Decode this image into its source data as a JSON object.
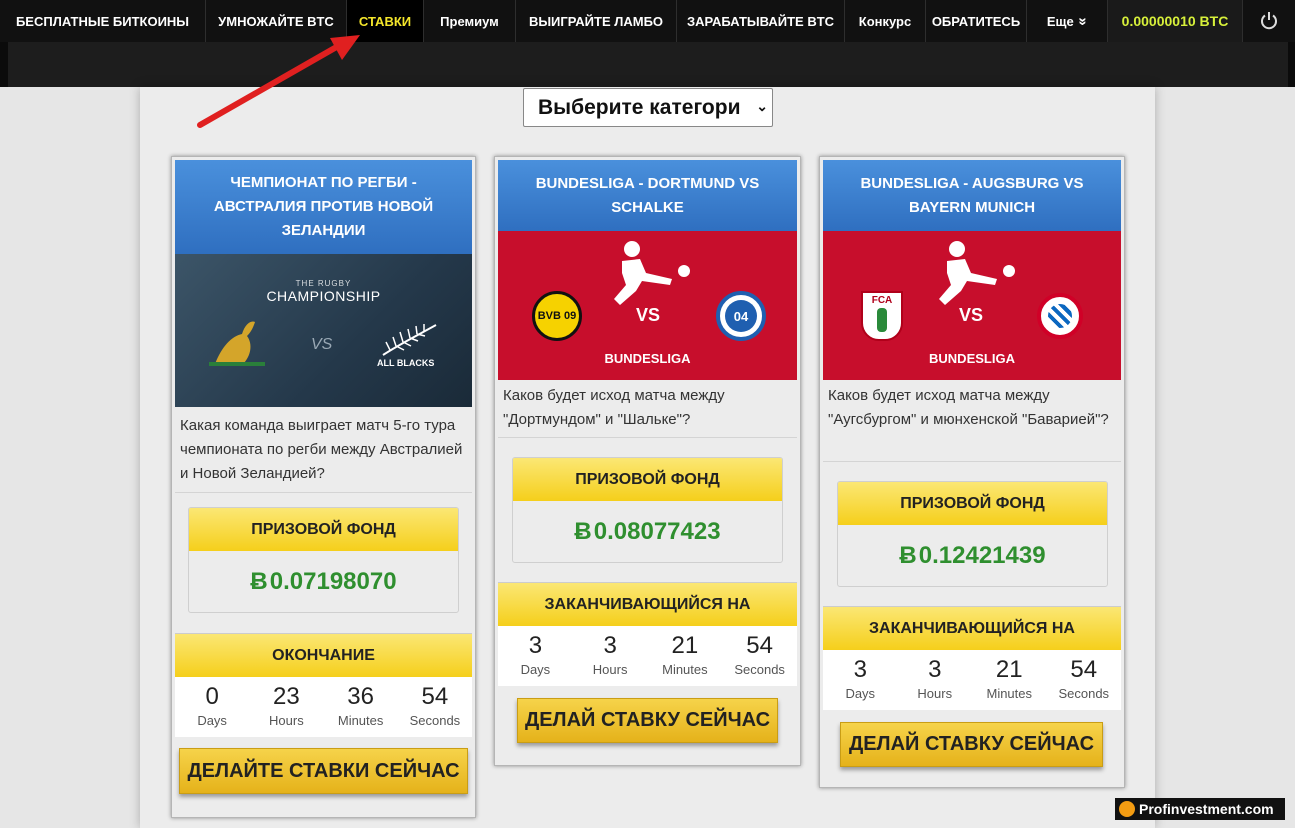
{
  "nav": {
    "items": [
      {
        "label": "БЕСПЛАТНЫЕ БИТКОИНЫ"
      },
      {
        "label": "УМНОЖАЙТЕ BTC"
      },
      {
        "label": "СТАВКИ"
      },
      {
        "label": "Премиум"
      },
      {
        "label": "ВЫИГРАЙТЕ ЛАМБО"
      },
      {
        "label": "ЗАРАБАТЫВАЙТЕ BTC"
      },
      {
        "label": "Конкурс"
      },
      {
        "label": "ОБРАТИТЕСЬ"
      },
      {
        "label": "Еще"
      }
    ],
    "balance": "0.00000010 BTC",
    "more_chevron": "»"
  },
  "category_select": {
    "value": "Выберите категори"
  },
  "btc_symbol": "Ƀ",
  "cards": [
    {
      "title": "ЧЕМПИОНАТ ПО РЕГБИ - АВСТРАЛИЯ ПРОТИВ НОВОЙ ЗЕЛАНДИИ",
      "image": {
        "brand_small": "THE RUGBY",
        "brand": "CHAMPIONSHIP",
        "team2": "ALL BLACKS",
        "vs": "VS"
      },
      "question": "Какая команда выиграет матч 5-го тура чемпионата по регби между Австралией и Новой Зеландией?",
      "prize_label": "ПРИЗОВОЙ ФОНД",
      "prize_value": "0.07198070",
      "ending_label": "ОКОНЧАНИЕ",
      "countdown": [
        {
          "num": "0",
          "unit": "Days"
        },
        {
          "num": "23",
          "unit": "Hours"
        },
        {
          "num": "36",
          "unit": "Minutes"
        },
        {
          "num": "54",
          "unit": "Seconds"
        }
      ],
      "button": "ДЕЛАЙТЕ СТАВКИ СЕЙЧАС"
    },
    {
      "title": "BUNDESLIGA - DORTMUND VS SCHALKE",
      "image": {
        "vs": "VS",
        "league": "BUNDESLIGA",
        "team1": "BVB 09",
        "team2": "04"
      },
      "question": "Каков будет исход матча между \"Дортмундом\" и \"Шальке\"?",
      "prize_label": "ПРИЗОВОЙ ФОНД",
      "prize_value": "0.08077423",
      "ending_label": "ЗАКАНЧИВАЮЩИЙСЯ НА",
      "countdown": [
        {
          "num": "3",
          "unit": "Days"
        },
        {
          "num": "3",
          "unit": "Hours"
        },
        {
          "num": "21",
          "unit": "Minutes"
        },
        {
          "num": "54",
          "unit": "Seconds"
        }
      ],
      "button": "ДЕЛАЙ СТАВКУ СЕЙЧАС"
    },
    {
      "title": "BUNDESLIGA - AUGSBURG VS BAYERN MUNICH",
      "image": {
        "vs": "VS",
        "league": "BUNDESLIGA",
        "team1": "FCA",
        "team2": "FCB"
      },
      "question": "Каков будет исход матча между \"Аугсбургом\" и мюнхенской \"Баварией\"?",
      "prize_label": "ПРИЗОВОЙ ФОНД",
      "prize_value": "0.12421439",
      "ending_label": "ЗАКАНЧИВАЮЩИЙСЯ НА",
      "countdown": [
        {
          "num": "3",
          "unit": "Days"
        },
        {
          "num": "3",
          "unit": "Hours"
        },
        {
          "num": "21",
          "unit": "Minutes"
        },
        {
          "num": "54",
          "unit": "Seconds"
        }
      ],
      "button": "ДЕЛАЙ СТАВКУ СЕЙЧАС"
    }
  ],
  "watermark": "Profinvestment.com",
  "colors": {
    "accent_yellow": "#f5cf1b",
    "balance": "#d7f03a",
    "prize_green": "#2f8f2f",
    "title_blue": "#3a7fd0",
    "bundesliga_red": "#c70e2c"
  }
}
